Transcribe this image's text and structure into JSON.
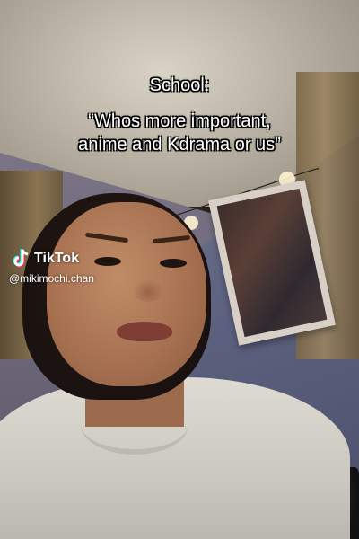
{
  "overlay": {
    "heading": "School:",
    "quote_line_1": "“Whos more important,",
    "quote_line_2": "anime and Kdrama or us”"
  },
  "watermark": {
    "brand": "TikTok",
    "handle": "@mikimochi.chan",
    "icon": "tiktok-logo-icon"
  },
  "colors": {
    "text": "#ffffff",
    "outline": "#000000",
    "tiktok_cyan": "#25f4ee",
    "tiktok_red": "#fe2c55"
  }
}
